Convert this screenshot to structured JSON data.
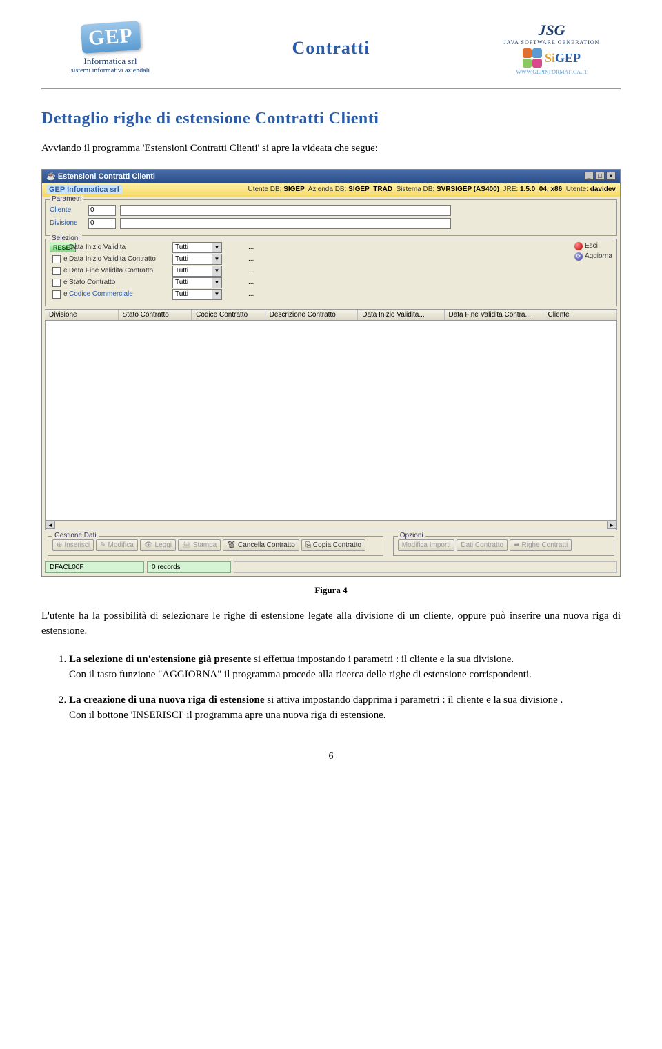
{
  "header": {
    "doc_title": "Contratti",
    "logo_left": {
      "main": "GEP",
      "sub1": "Informatica srl",
      "sub2": "sistemi informativi aziendali"
    },
    "logo_right": {
      "jsg": "JSG",
      "jsg_sub": "JAVA SOFTWARE GENERATION",
      "sigep": "SiGEP",
      "url": "WWW.GEPINFORMATICA.IT"
    }
  },
  "section_title": "Dettaglio righe di estensione Contratti Clienti",
  "intro": "Avviando il programma 'Estensioni Contratti Clienti' si apre la videata che segue:",
  "app": {
    "title": "Estensioni Contratti Clienti",
    "infobar_brand": "GEP Informatica srl",
    "infobar": {
      "utente_db_lbl": "Utente DB:",
      "utente_db": "SIGEP",
      "azienda_db_lbl": "Azienda DB:",
      "azienda_db": "SIGEP_TRAD",
      "sistema_db_lbl": "Sistema DB:",
      "sistema_db": "SVRSIGEP (AS400)",
      "jre_lbl": "JRE:",
      "jre": "1.5.0_04, x86",
      "utente_lbl": "Utente:",
      "utente": "davidev"
    },
    "parametri": {
      "legend": "Parametri",
      "cliente_lbl": "Cliente",
      "cliente_val": "0",
      "divisione_lbl": "Divisione",
      "divisione_val": "0"
    },
    "selezioni": {
      "legend": "Selezioni",
      "reset": "RESET",
      "rows": [
        {
          "e": "e",
          "name": "Data Inizio Validita",
          "val": "Tutti"
        },
        {
          "e": "e",
          "name": "Data Inizio Validita Contratto",
          "val": "Tutti"
        },
        {
          "e": "e",
          "name": "Data Fine Validita Contratto",
          "val": "Tutti"
        },
        {
          "e": "e",
          "name": "Stato Contratto",
          "val": "Tutti"
        },
        {
          "e": "e",
          "name": "Codice Commerciale",
          "val": "Tutti"
        }
      ],
      "side": {
        "esci": "Esci",
        "aggiorna": "Aggiorna"
      }
    },
    "columns": [
      "Divisione",
      "Stato Contratto",
      "Codice Contratto",
      "Descrizione Contratto",
      "Data Inizio Validita...",
      "Data Fine Validita Contra...",
      "Cliente"
    ],
    "gestione_dati": {
      "legend": "Gestione Dati",
      "buttons": [
        "Inserisci",
        "Modifica",
        "Leggi",
        "Stampa",
        "Cancella Contratto",
        "Copia Contratto"
      ]
    },
    "opzioni": {
      "legend": "Opzioni",
      "buttons": [
        "Modifica Importi",
        "Dati Contratto",
        "Righe Contratti"
      ]
    },
    "status": {
      "prog": "DFACL00F",
      "records": "0 records"
    }
  },
  "figure_caption": "Figura 4",
  "para_after": "L'utente ha la possibilità di selezionare le righe di estensione legate alla divisione di un cliente, oppure può inserire una nuova riga di estensione.",
  "list": {
    "item1_a": "La selezione di un'estensione già presente",
    "item1_b": " si effettua impostando i parametri : il cliente e la sua divisione.",
    "item1_c": "Con il tasto funzione \"AGGIORNA\" il programma procede alla ricerca delle righe di estensione corrispondenti.",
    "item2_a": "La creazione di una nuova riga di estensione",
    "item2_b": " si attiva impostando dapprima i parametri : il cliente e la sua divisione .",
    "item2_c": "Con il bottone 'INSERISCI' il programma apre una nuova riga di estensione."
  },
  "page_number": "6"
}
